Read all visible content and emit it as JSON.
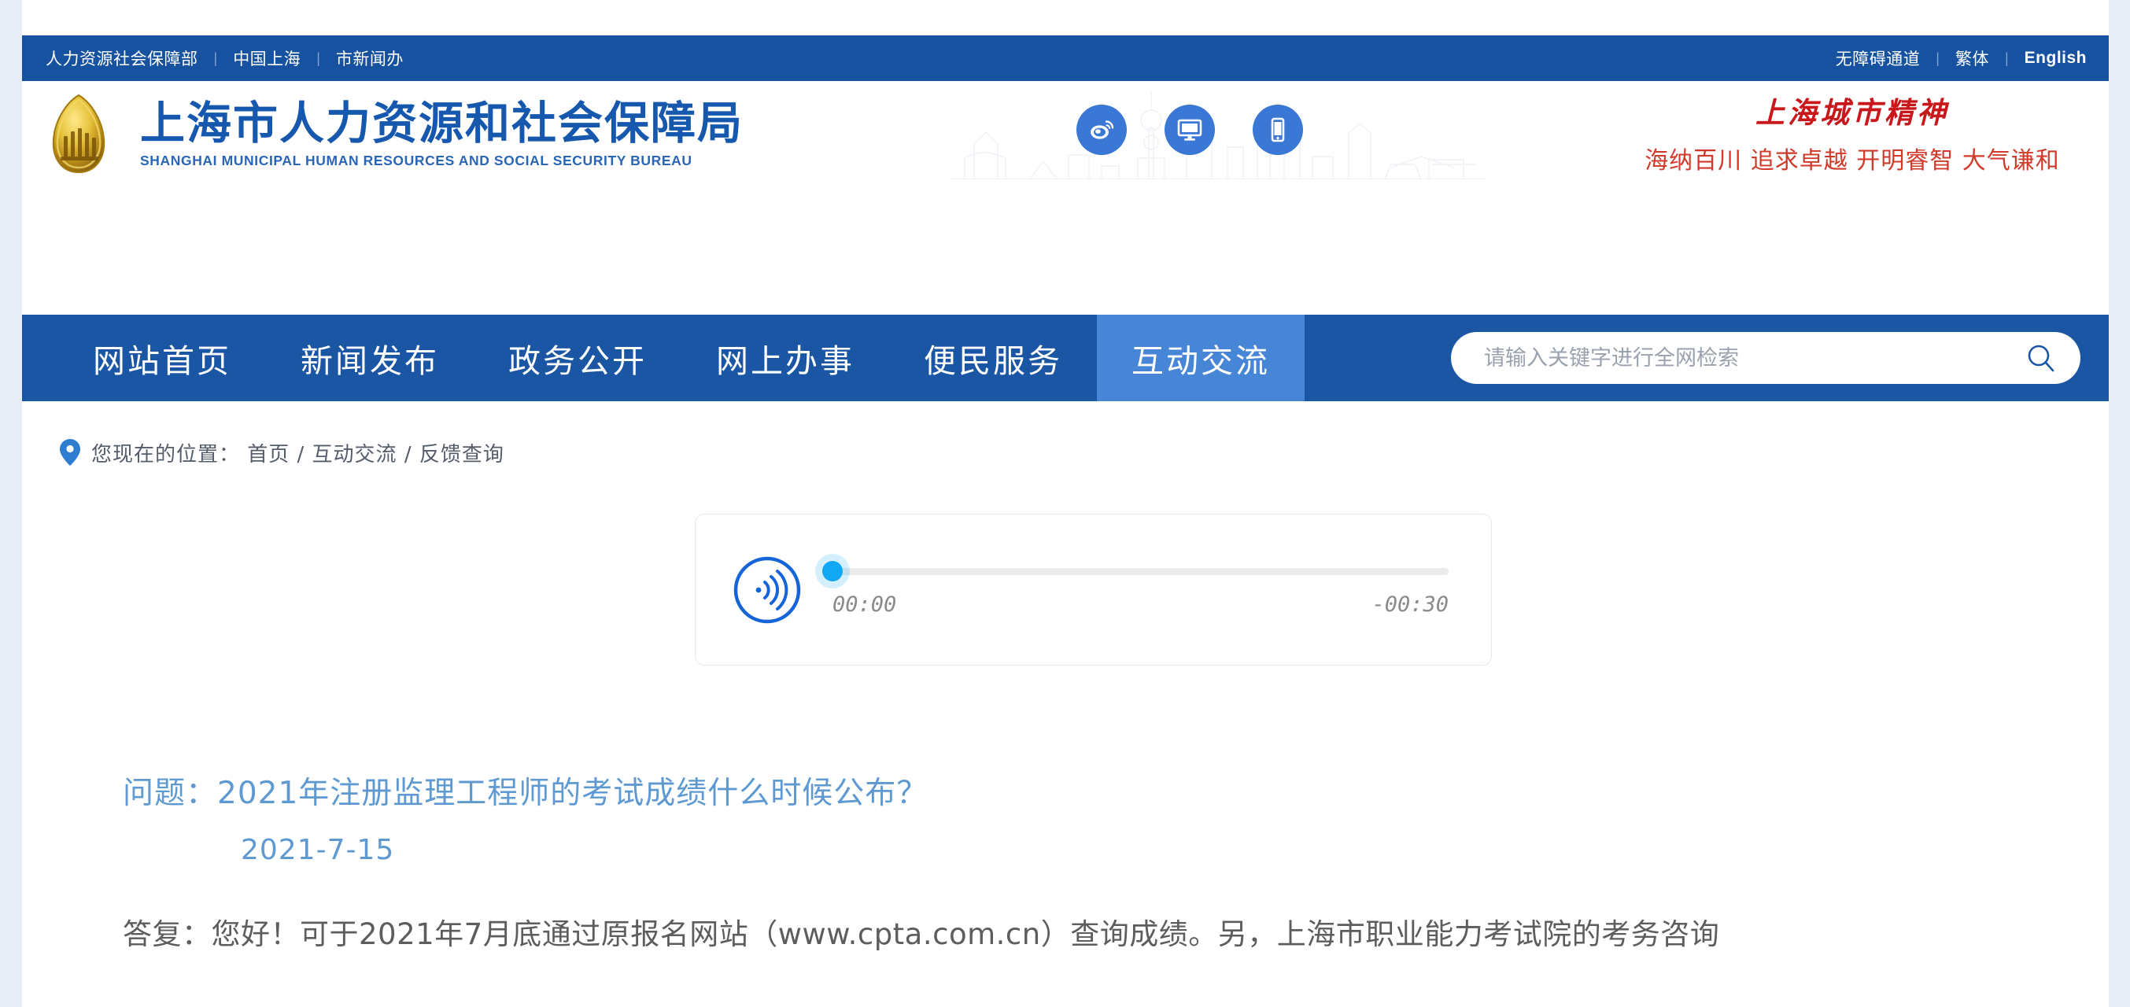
{
  "topbar": {
    "left_links": [
      "人力资源社会保障部",
      "中国上海",
      "市新闻办"
    ],
    "right_links": [
      "无障碍通道",
      "繁体",
      "English"
    ],
    "separator": "|",
    "bg_color": "#16529f"
  },
  "header": {
    "logo_cn": "上海市人力资源和社会保障局",
    "logo_en": "SHANGHAI MUNICIPAL HUMAN RESOURCES AND SOCIAL SECURITY BUREAU",
    "logo_color": "#1558ae",
    "emblem_icon": "shanghai-government-emblem-icon",
    "social_icons": [
      "weibo-icon",
      "desktop-monitor-icon",
      "mobile-phone-icon"
    ],
    "social_bg_color": "#3b77d4",
    "spirit_title": "上海城市精神",
    "spirit_subtitle": "海纳百川 追求卓越 开明睿智 大气谦和",
    "spirit_color": "#c8181c"
  },
  "nav": {
    "items": [
      {
        "label": "网站首页",
        "active": false
      },
      {
        "label": "新闻发布",
        "active": false
      },
      {
        "label": "政务公开",
        "active": false
      },
      {
        "label": "网上办事",
        "active": false
      },
      {
        "label": "便民服务",
        "active": false
      },
      {
        "label": "互动交流",
        "active": true
      }
    ],
    "bg_color": "#1b56a4",
    "active_color": "#4785d6"
  },
  "search": {
    "placeholder": "请输入关键字进行全网检索",
    "value": "",
    "icon": "search-icon"
  },
  "breadcrumb": {
    "icon": "location-pin-icon",
    "text": "您现在的位置： 首页 / 互动交流 / 反馈查询",
    "prefix": "您现在的位置：",
    "items": [
      "首页",
      "互动交流",
      "反馈查询"
    ]
  },
  "audio_player": {
    "play_icon": "sound-wave-icon",
    "current_time": "00:00",
    "remaining_time": "-00:30",
    "progress_percent": 0,
    "accent_color": "#11a7f5",
    "button_color": "#1565d8"
  },
  "content": {
    "question": "问题：2021年注册监理工程师的考试成绩什么时候公布？",
    "question_date": "2021-7-15",
    "question_color": "#5e9ad1",
    "answer": "答复：您好！可于2021年7月底通过原报名网站（www.cpta.com.cn）查询成绩。另，上海市职业能力考试院的考务咨询",
    "answer_color": "#5d5d5d"
  }
}
